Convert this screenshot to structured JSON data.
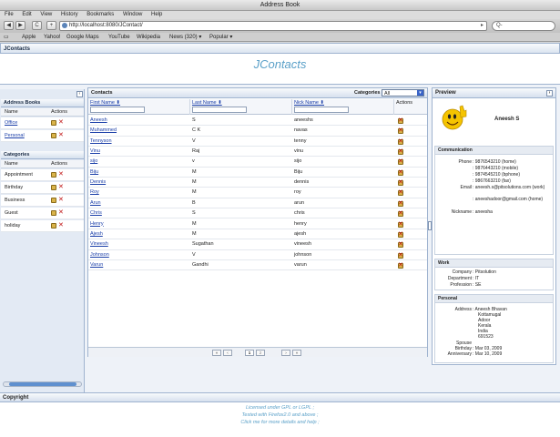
{
  "window": {
    "title": "Address Book"
  },
  "menu": [
    "File",
    "Edit",
    "View",
    "History",
    "Bookmarks",
    "Window",
    "Help"
  ],
  "nav": {
    "back": "◀",
    "forward": "▶",
    "reload": "C",
    "add": "+",
    "url": "http://localhost:8080/JContact/",
    "search_placeholder": "Q-"
  },
  "bookmarks": [
    "Apple",
    "Yahoo!",
    "Google Maps",
    "YouTube",
    "Wikipedia",
    "News (320) ▾",
    "Popular ▾"
  ],
  "app": {
    "header": "JContacts",
    "title": "JContacts"
  },
  "address_books": {
    "title": "Address Books",
    "col_name": "Name",
    "col_actions": "Actions",
    "items": [
      "Office",
      "Personal"
    ]
  },
  "categories_panel": {
    "title": "Categories",
    "col_name": "Name",
    "col_actions": "Actions",
    "items": [
      "Appointment",
      "Birthday",
      "Business",
      "Guest",
      "holiday"
    ]
  },
  "contacts": {
    "title": "Contacts",
    "category_label": "Categories",
    "category_value": "All",
    "columns": [
      "First Name ⬍",
      "Last Name ⬍",
      "Nick Name ⬍",
      "Actions"
    ],
    "rows": [
      [
        "Aneesh",
        "S",
        "aneeshs"
      ],
      [
        "Muhammed",
        "C K",
        "navas"
      ],
      [
        "Tennyson",
        "V",
        "tenny"
      ],
      [
        "Vinu",
        "Raj",
        "vinu"
      ],
      [
        "sijo",
        "v",
        "sijo"
      ],
      [
        "Biju",
        "M",
        "Biju"
      ],
      [
        "Dennis",
        "M",
        "dennis"
      ],
      [
        "Roy",
        "M",
        "roy"
      ],
      [
        "Arun",
        "B",
        "arun"
      ],
      [
        "Chris",
        "S",
        "chris"
      ],
      [
        "Henry",
        "M",
        "henry"
      ],
      [
        "Ajesh",
        "M",
        "ajesh"
      ],
      [
        "Vineesh",
        "Sugathan",
        "vineesh"
      ],
      [
        "Johnson",
        "V",
        "johnson"
      ],
      [
        "Varun",
        "Gandhi",
        "varun"
      ]
    ],
    "pager": {
      "first": "«",
      "prev": "‹",
      "page1": "1",
      "page2": "2",
      "next": "›",
      "last": "»"
    }
  },
  "preview": {
    "title": "Preview",
    "name": "Aneesh S",
    "communication": {
      "title": "Communication",
      "phone_label": "Phone",
      "phones": [
        ": 9876543210 (home)",
        ": 9876443210 (mobile)",
        ": 9874545210 (bphone)",
        ": 9867663210 (fax)"
      ],
      "email_label": "Email",
      "emails": [
        ": aneesh.s@pitsolutions.com (work)",
        ": aneeshadoor@gmail.com (home)"
      ],
      "nick_label": "Nickname",
      "nick": ": aneesha"
    },
    "work": {
      "title": "Work",
      "company_label": "Company",
      "company": ": Pitsolution",
      "dept_label": "Department",
      "dept": ": IT",
      "prof_label": "Profession",
      "prof": ": SE"
    },
    "personal": {
      "title": "Personal",
      "address_label": "Address",
      "address": [
        ": Aneesh Bhavan",
        "Kottamugal",
        "Adoor",
        "Kerala",
        "India",
        "691523"
      ],
      "spouse_label": "Spouse",
      "birthday_label": "Birthday",
      "birthday": ": Mar 03, 2009",
      "anniv_label": "Anniversary",
      "anniv": ": Mar 10, 2009"
    }
  },
  "copyright": {
    "title": "Copyright",
    "lines": [
      "Licensed under GPL or LGPL ;",
      "Tested with Firefox2.0 and above ;",
      "Click me for more details and help ;"
    ]
  },
  "colors": {
    "accent": "#5aa0c8",
    "link": "#1a3ea8",
    "delete": "#c01515",
    "border": "#9fb3cf"
  }
}
